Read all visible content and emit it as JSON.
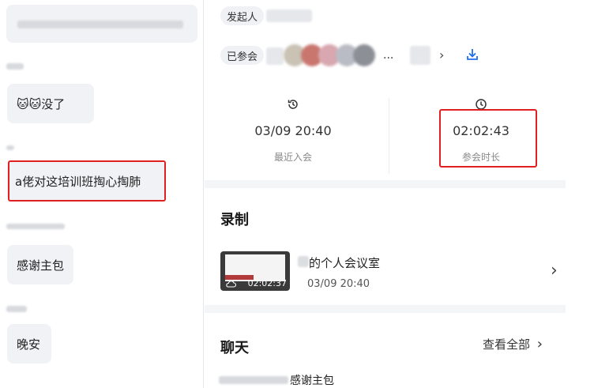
{
  "chat": {
    "messages": [
      {
        "text": ""
      },
      {
        "text": "🐱🐱没了"
      },
      {
        "text": "a佬对这培训班掏心掏肺"
      },
      {
        "text": "感谢主包"
      },
      {
        "text": "晚安"
      }
    ]
  },
  "meeting": {
    "initiator_label": "发起人",
    "joined_label": "已参会",
    "joined_more": "...",
    "recent_join": {
      "value": "03/09 20:40",
      "label": "最近入会"
    },
    "duration": {
      "value": "02:02:43",
      "label": "参会时长"
    }
  },
  "recording": {
    "section_title": "录制",
    "title": "的个人会议室",
    "date": "03/09 20:40",
    "thumb_duration": "02:02:37"
  },
  "chat_section": {
    "title": "聊天",
    "view_all": "查看全部",
    "preview_text": "感谢主包"
  },
  "colors": {
    "accent": "#1f6feb",
    "highlight": "#e02020",
    "bubble": "#f1f2f5"
  }
}
